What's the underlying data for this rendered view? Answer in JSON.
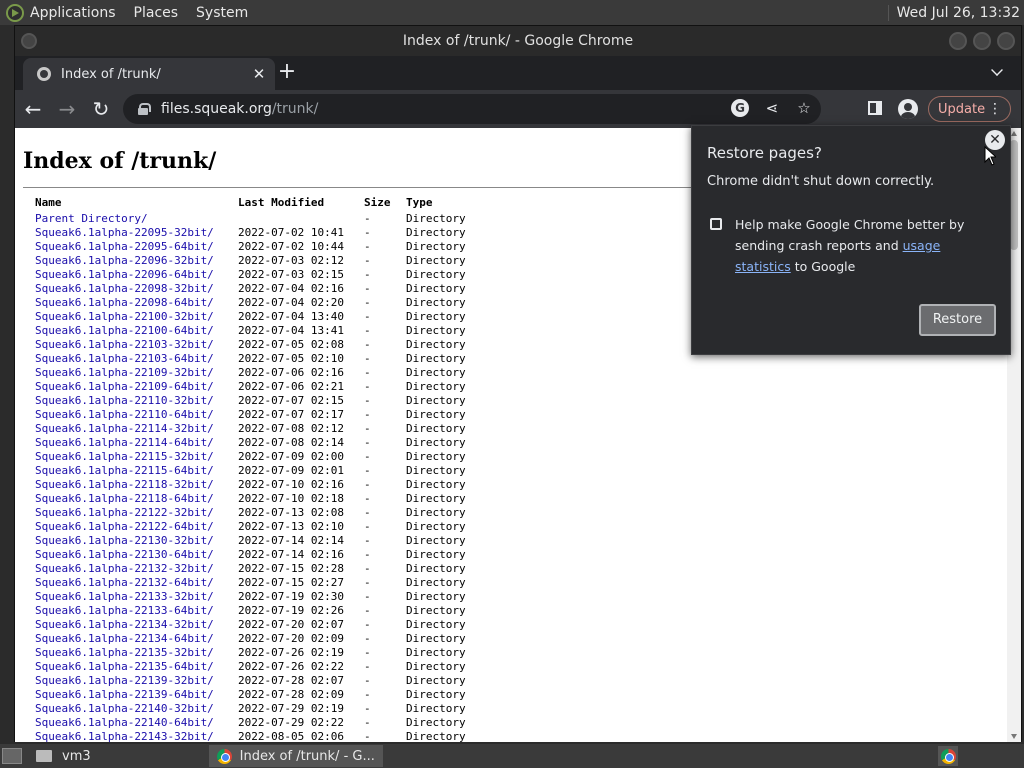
{
  "top_panel": {
    "menus": [
      "Applications",
      "Places",
      "System"
    ],
    "clock": "Wed Jul 26, 13:32"
  },
  "window": {
    "title": "Index of /trunk/ - Google Chrome"
  },
  "tab": {
    "title": "Index of /trunk/",
    "close": "✕",
    "new_tab": "+"
  },
  "toolbar": {
    "url_host": "files.squeak.org",
    "url_path": "/trunk/",
    "update_label": "Update",
    "back": "←",
    "forward": "→",
    "reload": "↻"
  },
  "page": {
    "heading": "Index of /trunk/",
    "columns": [
      "Name",
      "Last Modified",
      "Size",
      "Type"
    ],
    "rows": [
      [
        "Parent Directory/",
        "",
        "-",
        "Directory"
      ],
      [
        "Squeak6.1alpha-22095-32bit/",
        "2022-07-02 10:41",
        "-",
        "Directory"
      ],
      [
        "Squeak6.1alpha-22095-64bit/",
        "2022-07-02 10:44",
        "-",
        "Directory"
      ],
      [
        "Squeak6.1alpha-22096-32bit/",
        "2022-07-03 02:12",
        "-",
        "Directory"
      ],
      [
        "Squeak6.1alpha-22096-64bit/",
        "2022-07-03 02:15",
        "-",
        "Directory"
      ],
      [
        "Squeak6.1alpha-22098-32bit/",
        "2022-07-04 02:16",
        "-",
        "Directory"
      ],
      [
        "Squeak6.1alpha-22098-64bit/",
        "2022-07-04 02:20",
        "-",
        "Directory"
      ],
      [
        "Squeak6.1alpha-22100-32bit/",
        "2022-07-04 13:40",
        "-",
        "Directory"
      ],
      [
        "Squeak6.1alpha-22100-64bit/",
        "2022-07-04 13:41",
        "-",
        "Directory"
      ],
      [
        "Squeak6.1alpha-22103-32bit/",
        "2022-07-05 02:08",
        "-",
        "Directory"
      ],
      [
        "Squeak6.1alpha-22103-64bit/",
        "2022-07-05 02:10",
        "-",
        "Directory"
      ],
      [
        "Squeak6.1alpha-22109-32bit/",
        "2022-07-06 02:16",
        "-",
        "Directory"
      ],
      [
        "Squeak6.1alpha-22109-64bit/",
        "2022-07-06 02:21",
        "-",
        "Directory"
      ],
      [
        "Squeak6.1alpha-22110-32bit/",
        "2022-07-07 02:15",
        "-",
        "Directory"
      ],
      [
        "Squeak6.1alpha-22110-64bit/",
        "2022-07-07 02:17",
        "-",
        "Directory"
      ],
      [
        "Squeak6.1alpha-22114-32bit/",
        "2022-07-08 02:12",
        "-",
        "Directory"
      ],
      [
        "Squeak6.1alpha-22114-64bit/",
        "2022-07-08 02:14",
        "-",
        "Directory"
      ],
      [
        "Squeak6.1alpha-22115-32bit/",
        "2022-07-09 02:00",
        "-",
        "Directory"
      ],
      [
        "Squeak6.1alpha-22115-64bit/",
        "2022-07-09 02:01",
        "-",
        "Directory"
      ],
      [
        "Squeak6.1alpha-22118-32bit/",
        "2022-07-10 02:16",
        "-",
        "Directory"
      ],
      [
        "Squeak6.1alpha-22118-64bit/",
        "2022-07-10 02:18",
        "-",
        "Directory"
      ],
      [
        "Squeak6.1alpha-22122-32bit/",
        "2022-07-13 02:08",
        "-",
        "Directory"
      ],
      [
        "Squeak6.1alpha-22122-64bit/",
        "2022-07-13 02:10",
        "-",
        "Directory"
      ],
      [
        "Squeak6.1alpha-22130-32bit/",
        "2022-07-14 02:14",
        "-",
        "Directory"
      ],
      [
        "Squeak6.1alpha-22130-64bit/",
        "2022-07-14 02:16",
        "-",
        "Directory"
      ],
      [
        "Squeak6.1alpha-22132-32bit/",
        "2022-07-15 02:28",
        "-",
        "Directory"
      ],
      [
        "Squeak6.1alpha-22132-64bit/",
        "2022-07-15 02:27",
        "-",
        "Directory"
      ],
      [
        "Squeak6.1alpha-22133-32bit/",
        "2022-07-19 02:30",
        "-",
        "Directory"
      ],
      [
        "Squeak6.1alpha-22133-64bit/",
        "2022-07-19 02:26",
        "-",
        "Directory"
      ],
      [
        "Squeak6.1alpha-22134-32bit/",
        "2022-07-20 02:07",
        "-",
        "Directory"
      ],
      [
        "Squeak6.1alpha-22134-64bit/",
        "2022-07-20 02:09",
        "-",
        "Directory"
      ],
      [
        "Squeak6.1alpha-22135-32bit/",
        "2022-07-26 02:19",
        "-",
        "Directory"
      ],
      [
        "Squeak6.1alpha-22135-64bit/",
        "2022-07-26 02:22",
        "-",
        "Directory"
      ],
      [
        "Squeak6.1alpha-22139-32bit/",
        "2022-07-28 02:07",
        "-",
        "Directory"
      ],
      [
        "Squeak6.1alpha-22139-64bit/",
        "2022-07-28 02:09",
        "-",
        "Directory"
      ],
      [
        "Squeak6.1alpha-22140-32bit/",
        "2022-07-29 02:19",
        "-",
        "Directory"
      ],
      [
        "Squeak6.1alpha-22140-64bit/",
        "2022-07-29 02:22",
        "-",
        "Directory"
      ],
      [
        "Squeak6.1alpha-22143-32bit/",
        "2022-08-05 02:06",
        "-",
        "Directory"
      ]
    ]
  },
  "popup": {
    "title": "Restore pages?",
    "subtitle": "Chrome didn't shut down correctly.",
    "checkbox_text_before": "Help make Google Chrome better by sending crash reports and ",
    "checkbox_link": "usage statistics",
    "checkbox_text_after": " to Google",
    "restore_label": "Restore",
    "close": "✕"
  },
  "taskbar": {
    "items": [
      "vm3",
      "Index of /trunk/ - G..."
    ]
  },
  "colors": {
    "link": "#1a0dab",
    "update_text": "#f6aea9",
    "popup_link": "#8ab4f8"
  }
}
